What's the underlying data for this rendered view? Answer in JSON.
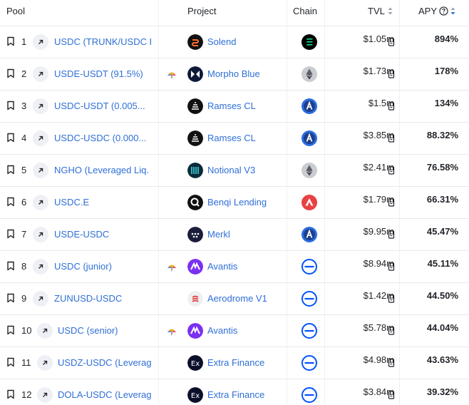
{
  "header": {
    "pool": "Pool",
    "project": "Project",
    "chain": "Chain",
    "tvl": "TVL",
    "apy": "APY"
  },
  "colors": {
    "link": "#2f6fd6",
    "text": "#1f2328",
    "sort_active": "#2f6fd6",
    "sort_inactive": "#9aa1ab"
  },
  "rows": [
    {
      "rank": "1",
      "pool": "USDC (TRUNK/USDC P",
      "project": "Solend",
      "project_icon": "solend-logo",
      "chain": "solana",
      "tvl": "$1.05m",
      "apy": "894%",
      "umbrella": false
    },
    {
      "rank": "2",
      "pool": "USDE-USDT (91.5%)",
      "project": "Morpho Blue",
      "project_icon": "morpho-logo",
      "chain": "ethereum",
      "tvl": "$1.73m",
      "apy": "178%",
      "umbrella": true
    },
    {
      "rank": "3",
      "pool": "USDC-USDT (0.005...",
      "project": "Ramses CL",
      "project_icon": "ramses-logo",
      "chain": "arbitrum",
      "tvl": "$1.5m",
      "apy": "134%",
      "umbrella": false
    },
    {
      "rank": "4",
      "pool": "USDC-USDC (0.000...",
      "project": "Ramses CL",
      "project_icon": "ramses-logo",
      "chain": "arbitrum",
      "tvl": "$3.85m",
      "apy": "88.32%",
      "umbrella": false
    },
    {
      "rank": "5",
      "pool": "NGHO (Leveraged Liq.",
      "project": "Notional V3",
      "project_icon": "notional-logo",
      "chain": "ethereum",
      "tvl": "$2.41m",
      "apy": "76.58%",
      "umbrella": false
    },
    {
      "rank": "6",
      "pool": "USDC.E",
      "project": "Benqi Lending",
      "project_icon": "benqi-logo",
      "chain": "avalanche",
      "tvl": "$1.79m",
      "apy": "66.31%",
      "umbrella": false
    },
    {
      "rank": "7",
      "pool": "USDE-USDC",
      "project": "Merkl",
      "project_icon": "merkl-logo",
      "chain": "arbitrum",
      "tvl": "$9.95m",
      "apy": "45.47%",
      "umbrella": false
    },
    {
      "rank": "8",
      "pool": "USDC (junior)",
      "project": "Avantis",
      "project_icon": "avantis-logo",
      "chain": "base",
      "tvl": "$8.94m",
      "apy": "45.11%",
      "umbrella": true
    },
    {
      "rank": "9",
      "pool": "ZUNUSD-USDC",
      "project": "Aerodrome V1",
      "project_icon": "aerodrome-logo",
      "chain": "base",
      "tvl": "$1.42m",
      "apy": "44.50%",
      "umbrella": false
    },
    {
      "rank": "10",
      "pool": "USDC (senior)",
      "project": "Avantis",
      "project_icon": "avantis-logo",
      "chain": "base",
      "tvl": "$5.78m",
      "apy": "44.04%",
      "umbrella": true
    },
    {
      "rank": "11",
      "pool": "USDZ-USDC (Leverag",
      "project": "Extra Finance",
      "project_icon": "extra-finance-logo",
      "chain": "base",
      "tvl": "$4.98m",
      "apy": "43.63%",
      "umbrella": false
    },
    {
      "rank": "12",
      "pool": "DOLA-USDC (Leverag",
      "project": "Extra Finance",
      "project_icon": "extra-finance-logo",
      "chain": "base",
      "tvl": "$3.84m",
      "apy": "39.32%",
      "umbrella": false
    }
  ]
}
